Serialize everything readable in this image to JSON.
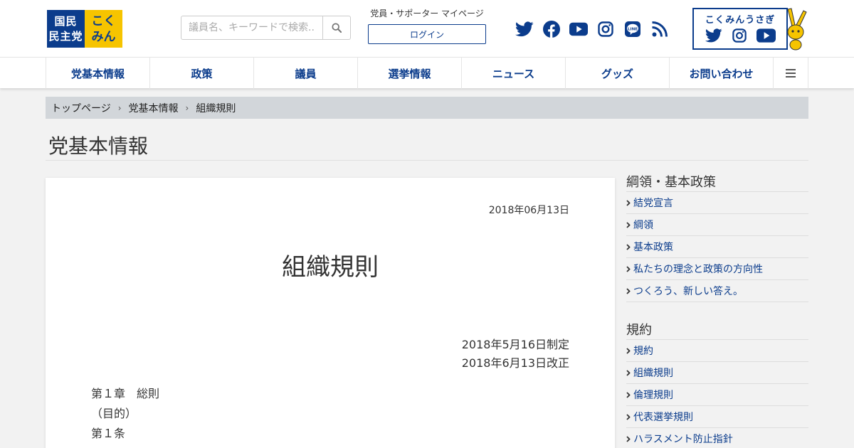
{
  "header": {
    "logo": {
      "line1": "国民",
      "line2": "民主党",
      "kana1": "こく",
      "kana2": "みん"
    },
    "search": {
      "placeholder": "議員名、キーワードで検索..."
    },
    "member": {
      "title": "党員・サポーター マイページ",
      "login_label": "ログイン"
    },
    "social_icons": [
      "twitter-icon",
      "facebook-icon",
      "youtube-icon",
      "instagram-icon",
      "line-icon",
      "rss-icon"
    ],
    "kokumin_usagi": {
      "title": "こくみんうさぎ"
    }
  },
  "nav": {
    "items": [
      {
        "label": "党基本情報"
      },
      {
        "label": "政策"
      },
      {
        "label": "議員"
      },
      {
        "label": "選挙情報"
      },
      {
        "label": "ニュース"
      },
      {
        "label": "グッズ"
      },
      {
        "label": "お問い合わせ"
      }
    ],
    "menu_icon": "hamburger-icon"
  },
  "breadcrumb": [
    "トップページ",
    "党基本情報",
    "組織規則"
  ],
  "section_title": "党基本情報",
  "article": {
    "date": "2018年06月13日",
    "title": "組織規則",
    "revisions": [
      "2018年5月16日制定",
      "2018年6月13日改正"
    ],
    "lines": [
      "第１章　総則",
      "（目的）",
      "第１条"
    ]
  },
  "sidebar": {
    "groups": [
      {
        "heading": "綱領・基本政策",
        "items": [
          "結党宣言",
          "綱領",
          "基本政策",
          "私たちの理念と政策の方向性",
          "つくろう、新しい答え。"
        ]
      },
      {
        "heading": "規約",
        "items": [
          "規約",
          "組織規則",
          "倫理規則",
          "代表選挙規則",
          "ハラスメント防止指針"
        ]
      }
    ]
  },
  "colors": {
    "brand_blue": "#0b3c8c",
    "brand_yellow": "#f6c400",
    "breadcrumb_bg": "#d2d6da"
  }
}
